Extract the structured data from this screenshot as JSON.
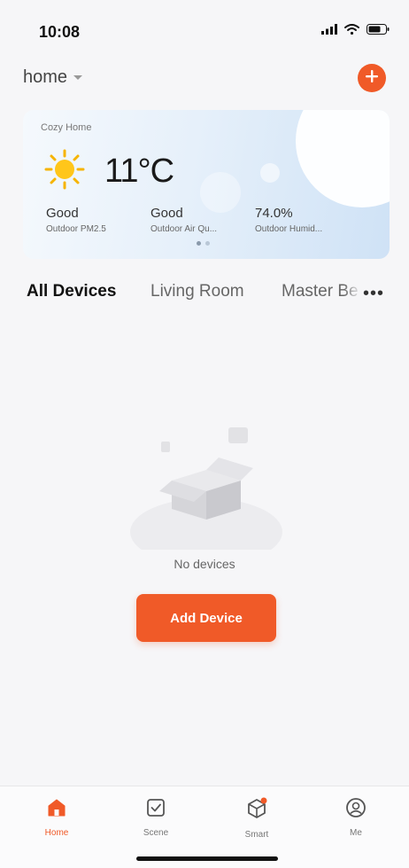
{
  "status_bar": {
    "time": "10:08",
    "icons": [
      "signal-icon",
      "wifi-icon",
      "battery-icon"
    ]
  },
  "header": {
    "home_name": "home",
    "home_dropdown_icon": "caret-down-icon",
    "add_icon": "plus-circle-icon"
  },
  "weather_card": {
    "title": "Cozy Home",
    "weather_icon": "sun-icon",
    "temperature": "11°C",
    "metrics": [
      {
        "value": "Good",
        "label": "Outdoor PM2.5"
      },
      {
        "value": "Good",
        "label": "Outdoor Air Qu..."
      },
      {
        "value": "74.0%",
        "label": "Outdoor Humid..."
      }
    ],
    "pages": 2,
    "active_page": 1
  },
  "tabs": {
    "items": [
      "All Devices",
      "Living Room",
      "Master Be"
    ],
    "active_index": 0,
    "more_label": "•••"
  },
  "empty_state": {
    "icon": "empty-box-icon",
    "text": "No devices",
    "button_label": "Add Device"
  },
  "bottom_nav": {
    "items": [
      {
        "label": "Home",
        "icon": "home-icon"
      },
      {
        "label": "Scene",
        "icon": "scene-checkbox-icon"
      },
      {
        "label": "Smart",
        "icon": "smart-cube-icon"
      },
      {
        "label": "Me",
        "icon": "profile-icon"
      }
    ],
    "active_index": 0
  },
  "colors": {
    "accent": "#f05a28",
    "background": "#f6f6f8",
    "card_gradient_end": "#cfe2f6"
  }
}
